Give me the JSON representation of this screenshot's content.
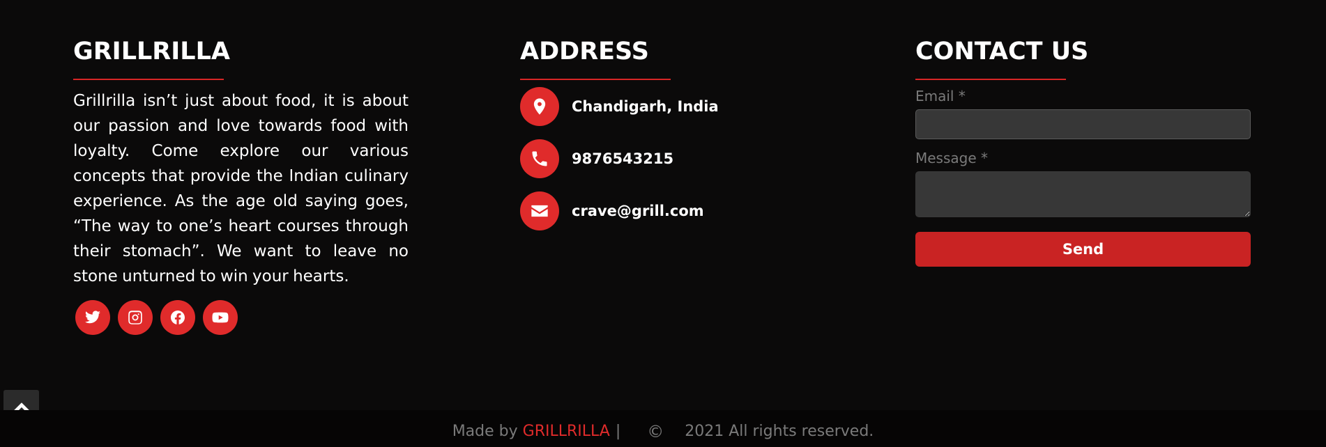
{
  "about": {
    "title": "GRILLRILLA",
    "text": "Grillrilla isn’t just about food, it is about our passion and love towards food with loyalty. Come explore our various concepts that provide the Indian culinary experience. As the age old saying goes, “The way to one’s heart courses through their stomach”. We want to leave no stone unturned to win your hearts.",
    "social": [
      {
        "icon": "twitter-icon"
      },
      {
        "icon": "instagram-icon"
      },
      {
        "icon": "facebook-icon"
      },
      {
        "icon": "youtube-icon"
      }
    ]
  },
  "address": {
    "title": "ADDRESS",
    "items": [
      {
        "icon": "location-pin-icon",
        "text": "Chandigarh, India"
      },
      {
        "icon": "phone-icon",
        "text": "9876543215"
      },
      {
        "icon": "envelope-icon",
        "text": "crave@grill.com"
      }
    ]
  },
  "contact": {
    "title": "CONTACT US",
    "email_label": "Email *",
    "email_value": "",
    "message_label": "Message *",
    "message_value": "",
    "send_label": "Send"
  },
  "footer": {
    "made_by": "Made by",
    "brand": "GRILLRILLA",
    "separator": "|",
    "copyright_symbol": "©",
    "rights": "2021 All rights reserved."
  },
  "colors": {
    "accent": "#e02b2b",
    "background": "#0b0a0a",
    "input_bg": "#373737"
  }
}
